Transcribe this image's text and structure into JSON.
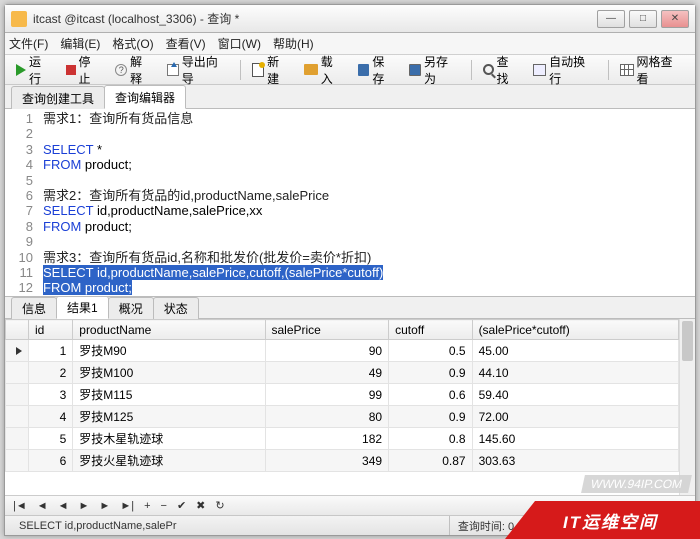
{
  "window": {
    "title": "itcast @itcast (localhost_3306) - 查询 *"
  },
  "menu": {
    "file": "文件(F)",
    "edit": "编辑(E)",
    "format": "格式(O)",
    "view": "查看(V)",
    "window": "窗口(W)",
    "help": "帮助(H)"
  },
  "toolbar": {
    "run": "运行",
    "stop": "停止",
    "explain": "解释",
    "export": "导出向导",
    "new": "新建",
    "load": "载入",
    "save": "保存",
    "saveas": "另存为",
    "find": "查找",
    "wrap": "自动换行",
    "gridview": "网格查看"
  },
  "editorTabs": {
    "builder": "查询创建工具",
    "editor": "查询编辑器"
  },
  "code": {
    "l1": "需求1：查询所有货品信息",
    "l3a": "SELECT",
    "l3b": " *",
    "l4a": "FROM",
    "l4b": " product;",
    "l6": "需求2：查询所有货品的id,productName,salePrice",
    "l7a": "SELECT",
    "l7b": " id,productName,salePrice,xx",
    "l8a": "FROM",
    "l8b": " product;",
    "l10": "需求3：查询所有货品id,名称和批发价(批发价=卖价*折扣)",
    "l11": "SELECT id,productName,salePrice,cutoff,(salePrice*cutoff)",
    "l12": "FROM product;"
  },
  "gutterLines": [
    "1",
    "2",
    "3",
    "4",
    "5",
    "6",
    "7",
    "8",
    "9",
    "10",
    "11",
    "12"
  ],
  "resultTabs": {
    "info": "信息",
    "result": "结果1",
    "overview": "概况",
    "status": "状态"
  },
  "columns": {
    "id": "id",
    "productName": "productName",
    "salePrice": "salePrice",
    "cutoff": "cutoff",
    "calc": "(salePrice*cutoff)"
  },
  "rows": [
    {
      "id": "1",
      "productName": "罗技M90",
      "salePrice": "90",
      "cutoff": "0.5",
      "calc": "45.00"
    },
    {
      "id": "2",
      "productName": "罗技M100",
      "salePrice": "49",
      "cutoff": "0.9",
      "calc": "44.10"
    },
    {
      "id": "3",
      "productName": "罗技M115",
      "salePrice": "99",
      "cutoff": "0.6",
      "calc": "59.40"
    },
    {
      "id": "4",
      "productName": "罗技M125",
      "salePrice": "80",
      "cutoff": "0.9",
      "calc": "72.00"
    },
    {
      "id": "5",
      "productName": "罗技木星轨迹球",
      "salePrice": "182",
      "cutoff": "0.8",
      "calc": "145.60"
    },
    {
      "id": "6",
      "productName": "罗技火星轨迹球",
      "salePrice": "349",
      "cutoff": "0.87",
      "calc": "303.63"
    }
  ],
  "nav": {
    "first": "|◄",
    "prev": "◄",
    "prev1": "◄",
    "next": "►",
    "next1": "►",
    "last": "►|",
    "add": "+",
    "del": "−",
    "ok": "✔",
    "cancel": "✖",
    "refresh": "↻"
  },
  "status": {
    "query": "SELECT id,productName,salePr",
    "timeLabel": "查询时间: 0.000s"
  },
  "watermark": {
    "url": "WWW.94IP.COM",
    "brand": "IT运维空间"
  }
}
